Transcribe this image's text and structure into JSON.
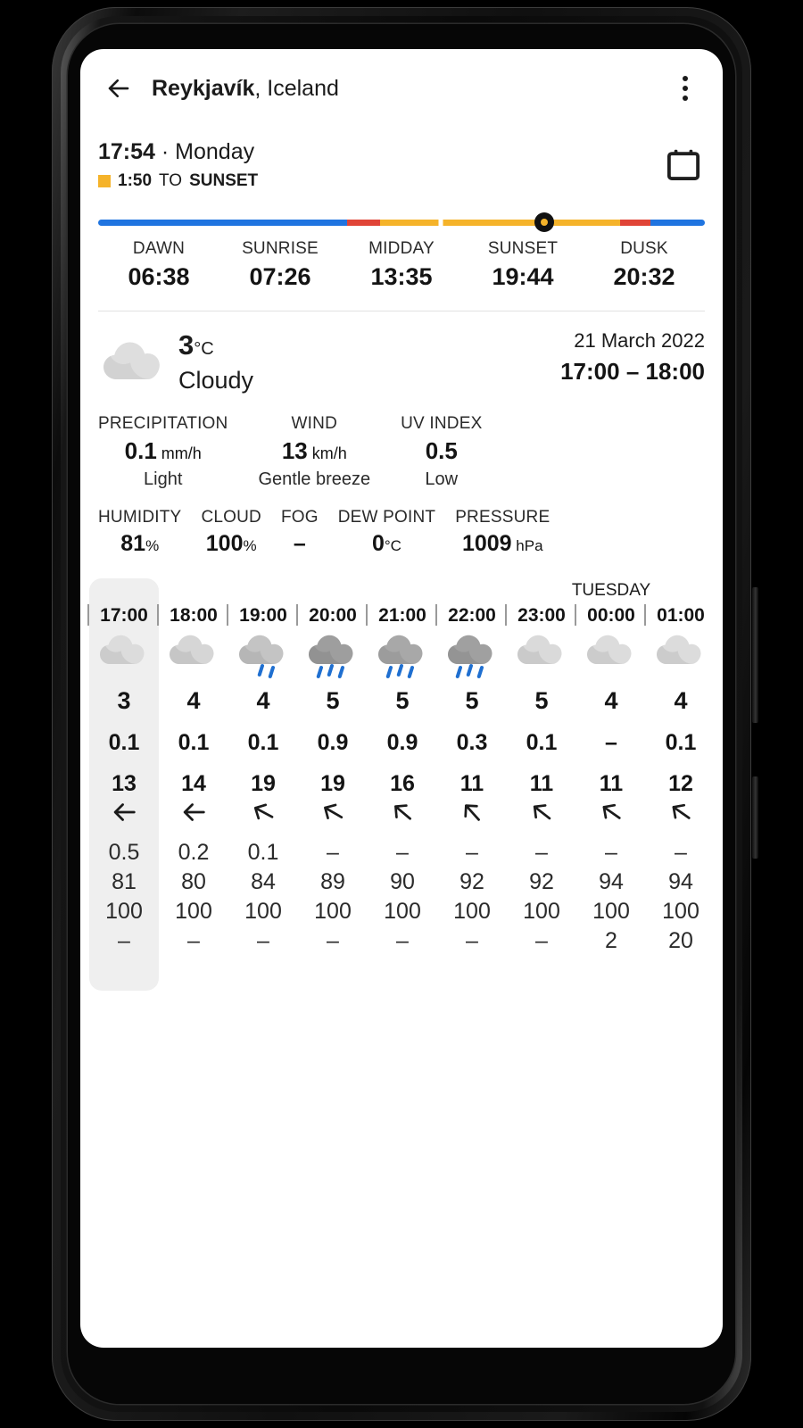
{
  "appbar": {
    "back_icon": "arrow-left-icon",
    "city": "Reykjavík",
    "country": ", Iceland",
    "overflow_icon": "more-vertical-icon"
  },
  "sun": {
    "clock_time": "17:54",
    "clock_sep": " · ",
    "clock_day": "Monday",
    "countdown": "1:50",
    "countdown_mid": " TO ",
    "countdown_target": "SUNSET",
    "calendar_icon": "calendar-icon",
    "marker_position_pct": 73.5,
    "colors": {
      "night": "#1f74e0",
      "twilight": "#e04437",
      "day": "#f5b32a",
      "marker_ring": "#111111",
      "marker_dot": "#f5b32a"
    },
    "segments": [
      {
        "color": "#1f74e0",
        "pct": 41.0
      },
      {
        "color": "#e04437",
        "pct": 5.5
      },
      {
        "color": "#f5b32a",
        "pct": 39.5
      },
      {
        "color": "#e04437",
        "pct": 5.0
      },
      {
        "color": "#1f74e0",
        "pct": 9.0
      }
    ],
    "midday_gap_pct": 56.5,
    "events": [
      {
        "label": "DAWN",
        "value": "06:38"
      },
      {
        "label": "SUNRISE",
        "value": "07:26"
      },
      {
        "label": "MIDDAY",
        "value": "13:35"
      },
      {
        "label": "SUNSET",
        "value": "19:44"
      },
      {
        "label": "DUSK",
        "value": "20:32"
      }
    ]
  },
  "current": {
    "icon": "cloudy-icon",
    "temperature": "3",
    "temperature_unit": "°C",
    "condition": "Cloudy",
    "date": "21 March 2022",
    "time_range": "17:00 – 18:00",
    "metrics": [
      {
        "label": "PRECIPITATION",
        "value": "0.1",
        "unit": " mm/h",
        "sub": "Light"
      },
      {
        "label": "WIND",
        "value": "13",
        "unit": " km/h",
        "sub": "Gentle breeze"
      },
      {
        "label": "UV INDEX",
        "value": "0.5",
        "unit": "",
        "sub": "Low"
      }
    ],
    "metrics2": [
      {
        "label": "HUMIDITY",
        "value": "81",
        "unit": "%"
      },
      {
        "label": "CLOUD",
        "value": "100",
        "unit": "%"
      },
      {
        "label": "FOG",
        "value": "–",
        "unit": ""
      },
      {
        "label": "DEW POINT",
        "value": "0",
        "unit": "°C"
      },
      {
        "label": "PRESSURE",
        "value": "1009",
        "unit": " hPa"
      }
    ]
  },
  "hourly": {
    "selected_index": 0,
    "columns": [
      {
        "day": "",
        "time": "17:00",
        "icon": "cloudy-icon",
        "cloud_shade": "#dcdcdc",
        "rain_drops": 0,
        "temp": "3",
        "precip": "0.1",
        "wind": "13",
        "wind_dir_deg": 270,
        "uv": "0.5",
        "humidity": "81",
        "cloud": "100",
        "fog": "–"
      },
      {
        "day": "",
        "time": "18:00",
        "icon": "cloudy-icon",
        "cloud_shade": "#d6d6d6",
        "rain_drops": 0,
        "temp": "4",
        "precip": "0.1",
        "wind": "14",
        "wind_dir_deg": 270,
        "uv": "0.2",
        "humidity": "80",
        "cloud": "100",
        "fog": "–"
      },
      {
        "day": "",
        "time": "19:00",
        "icon": "rain-light-icon",
        "cloud_shade": "#c4c4c4",
        "rain_drops": 2,
        "temp": "4",
        "precip": "0.1",
        "wind": "19",
        "wind_dir_deg": 298,
        "uv": "0.1",
        "humidity": "84",
        "cloud": "100",
        "fog": "–"
      },
      {
        "day": "",
        "time": "20:00",
        "icon": "rain-icon",
        "cloud_shade": "#9e9e9e",
        "rain_drops": 3,
        "temp": "5",
        "precip": "0.9",
        "wind": "19",
        "wind_dir_deg": 300,
        "uv": "–",
        "humidity": "89",
        "cloud": "100",
        "fog": "–"
      },
      {
        "day": "",
        "time": "21:00",
        "icon": "rain-icon",
        "cloud_shade": "#a8a8a8",
        "rain_drops": 3,
        "temp": "5",
        "precip": "0.9",
        "wind": "16",
        "wind_dir_deg": 310,
        "uv": "–",
        "humidity": "90",
        "cloud": "100",
        "fog": "–"
      },
      {
        "day": "",
        "time": "22:00",
        "icon": "rain-icon",
        "cloud_shade": "#a0a0a0",
        "rain_drops": 3,
        "temp": "5",
        "precip": "0.3",
        "wind": "11",
        "wind_dir_deg": 318,
        "uv": "–",
        "humidity": "92",
        "cloud": "100",
        "fog": "–"
      },
      {
        "day": "",
        "time": "23:00",
        "icon": "cloudy-icon",
        "cloud_shade": "#dadada",
        "rain_drops": 0,
        "temp": "5",
        "precip": "0.1",
        "wind": "11",
        "wind_dir_deg": 308,
        "uv": "–",
        "humidity": "92",
        "cloud": "100",
        "fog": "–"
      },
      {
        "day": "TUESDAY",
        "time": "00:00",
        "icon": "cloudy-icon",
        "cloud_shade": "#dcdcdc",
        "rain_drops": 0,
        "temp": "4",
        "precip": "–",
        "wind": "11",
        "wind_dir_deg": 305,
        "uv": "–",
        "humidity": "94",
        "cloud": "100",
        "fog": "2"
      },
      {
        "day": "",
        "time": "01:00",
        "icon": "cloudy-icon",
        "cloud_shade": "#dcdcdc",
        "rain_drops": 0,
        "temp": "4",
        "precip": "0.1",
        "wind": "12",
        "wind_dir_deg": 305,
        "uv": "–",
        "humidity": "94",
        "cloud": "100",
        "fog": "20"
      }
    ]
  }
}
